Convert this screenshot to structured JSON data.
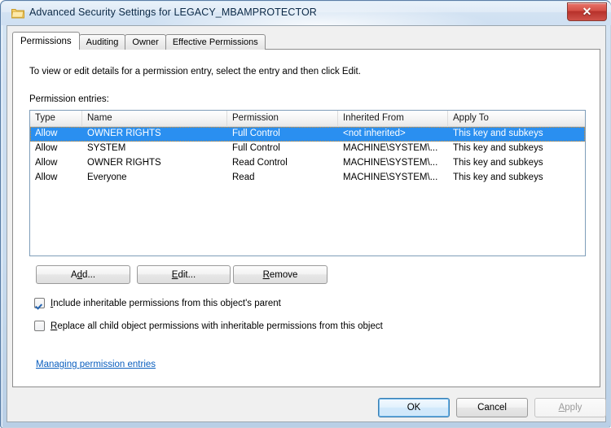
{
  "window": {
    "title": "Advanced Security Settings for LEGACY_MBAMPROTECTOR",
    "icon": "folder-icon",
    "close_glyph": "✕",
    "accent_selection": "#2a8ff0",
    "link_color": "#0b5fbf"
  },
  "tabs": [
    {
      "label": "Permissions",
      "active": true
    },
    {
      "label": "Auditing",
      "active": false
    },
    {
      "label": "Owner",
      "active": false
    },
    {
      "label": "Effective Permissions",
      "active": false
    }
  ],
  "panel": {
    "instruction": "To view or edit details for a permission entry, select the entry and then click Edit.",
    "entries_label": "Permission entries:"
  },
  "table": {
    "columns": [
      "Type",
      "Name",
      "Permission",
      "Inherited From",
      "Apply To"
    ],
    "rows": [
      {
        "type": "Allow",
        "name": "OWNER RIGHTS",
        "permission": "Full Control",
        "inherited_from": "<not inherited>",
        "apply_to": "This key and subkeys",
        "selected": true
      },
      {
        "type": "Allow",
        "name": "SYSTEM",
        "permission": "Full Control",
        "inherited_from": "MACHINE\\SYSTEM\\...",
        "apply_to": "This key and subkeys",
        "selected": false
      },
      {
        "type": "Allow",
        "name": "OWNER RIGHTS",
        "permission": "Read Control",
        "inherited_from": "MACHINE\\SYSTEM\\...",
        "apply_to": "This key and subkeys",
        "selected": false
      },
      {
        "type": "Allow",
        "name": "Everyone",
        "permission": "Read",
        "inherited_from": "MACHINE\\SYSTEM\\...",
        "apply_to": "This key and subkeys",
        "selected": false
      }
    ]
  },
  "entry_buttons": {
    "add": {
      "pre": "A",
      "key": "d",
      "post": "d..."
    },
    "edit": {
      "pre": "",
      "key": "E",
      "post": "dit..."
    },
    "remove": {
      "pre": "",
      "key": "R",
      "post": "emove"
    }
  },
  "checkboxes": {
    "inherit": {
      "checked": true,
      "pre": "",
      "key": "I",
      "post": "nclude inheritable permissions from this object's parent"
    },
    "replace": {
      "checked": false,
      "pre": "",
      "key": "R",
      "post": "eplace all child object permissions with inheritable permissions from this object"
    }
  },
  "link": {
    "label": "Managing permission entries"
  },
  "footer": {
    "ok": "OK",
    "cancel": "Cancel",
    "apply": {
      "pre": "",
      "key": "A",
      "post": "pply",
      "disabled": true
    }
  }
}
